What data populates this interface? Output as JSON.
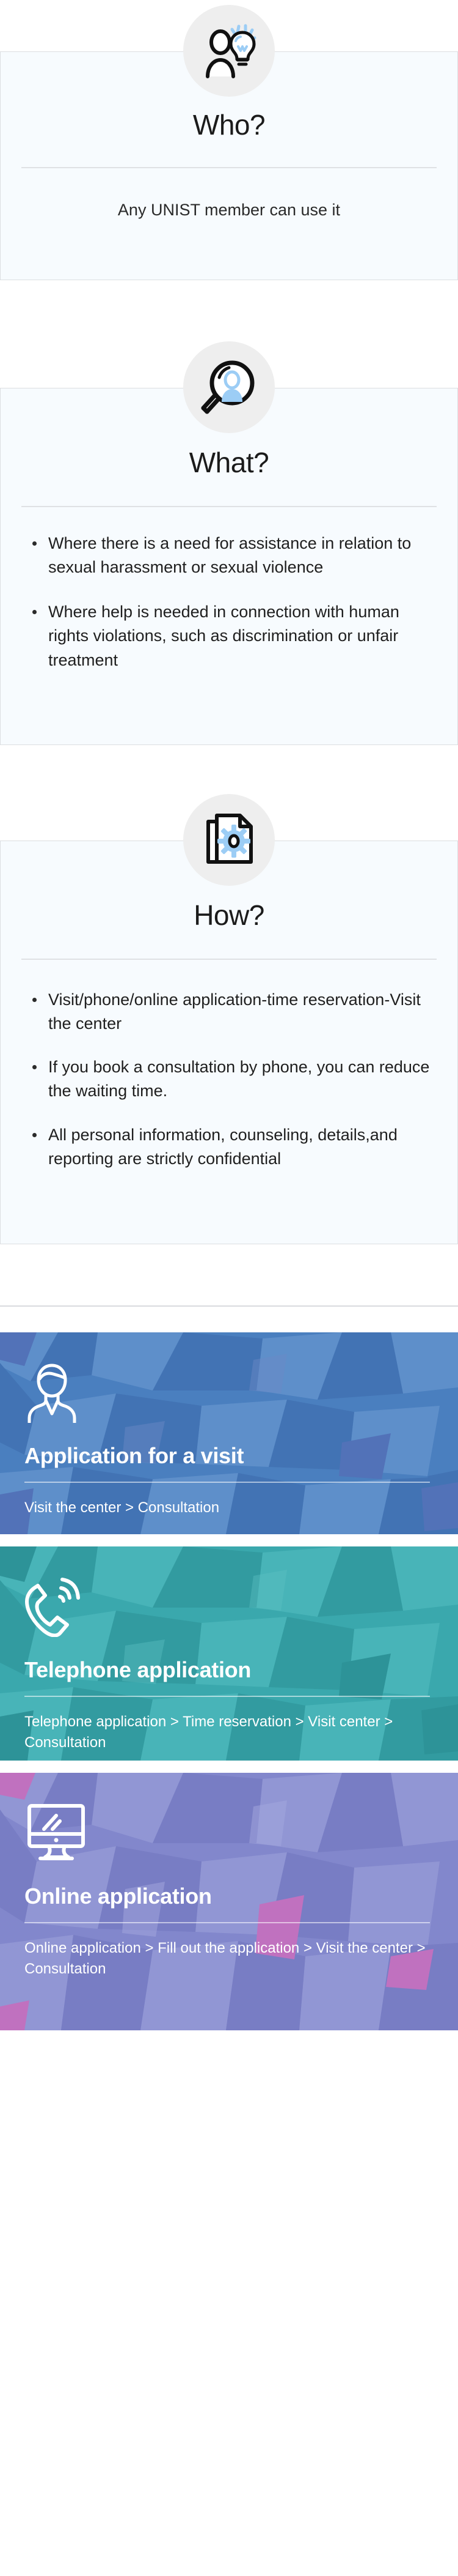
{
  "info_cards": [
    {
      "id": "who",
      "icon": "person-lightbulb-icon",
      "title": "Who?",
      "lead": "Any UNIST member can use it",
      "bullets": []
    },
    {
      "id": "what",
      "icon": "magnifier-person-icon",
      "title": "What?",
      "lead": "",
      "bullets": [
        "Where there is a need for assistance in relation to sexual harassment or sexual violence",
        "Where help is needed in connection with human rights violations, such as discrimination or unfair treatment"
      ]
    },
    {
      "id": "how",
      "icon": "document-gear-icon",
      "title": "How?",
      "lead": "",
      "bullets": [
        "Visit/phone/online application-time reservation-Visit the center",
        "If you book a consultation by phone, you can reduce the waiting time.",
        "All personal information, counseling, details,and reporting are strictly confidential"
      ]
    }
  ],
  "banners": [
    {
      "id": "visit",
      "icon": "person-bust-icon",
      "title": "Application for a visit",
      "subtitle": "Visit the center > Consultation",
      "color": "#4a7fbf"
    },
    {
      "id": "telephone",
      "icon": "phone-ringing-icon",
      "title": "Telephone application",
      "subtitle": "Telephone application > Time reservation > Visit center > Consultation",
      "color": "#3aa8ad"
    },
    {
      "id": "online",
      "icon": "desktop-monitor-icon",
      "title": "Online application",
      "subtitle": "Online application > Fill out the application > Visit the center > Consultation",
      "color": "#8287cc"
    }
  ],
  "accent_colors": {
    "icon_badge_bg": "#eeeeee",
    "icon_highlight": "#9ccdf5",
    "card_bg": "#f7fbfe",
    "card_border": "#dcdee1",
    "blue": "#4a7fbf",
    "teal": "#3aa8ad",
    "purple": "#8287cc"
  }
}
